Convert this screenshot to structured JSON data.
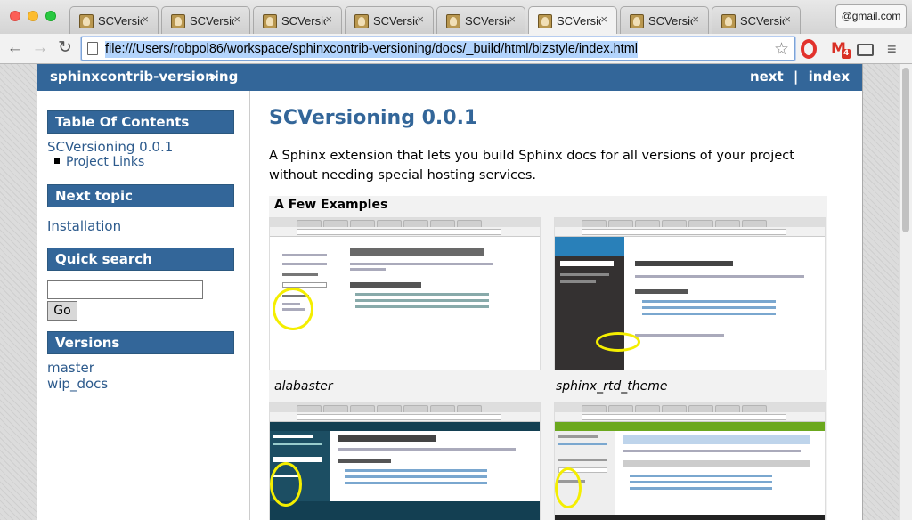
{
  "browser": {
    "tabs": [
      {
        "label": "SCVersioning"
      },
      {
        "label": "SCVersioning"
      },
      {
        "label": "SCVersioning"
      },
      {
        "label": "SCVersioning"
      },
      {
        "label": "SCVersioning"
      },
      {
        "label": "SCVersioning"
      },
      {
        "label": "SCVersioning"
      },
      {
        "label": "SCVersioning"
      }
    ],
    "tab_close_glyph": "×",
    "profile_label": "@gmail.com",
    "url": "file:///Users/robpol86/workspace/sphinxcontrib-versioning/docs/_build/html/bizstyle/index.html",
    "gmail_badge": "4",
    "icons": {
      "back": "back-arrow-icon",
      "forward": "forward-arrow-icon",
      "reload": "reload-icon",
      "star": "star-icon",
      "menu": "menu-icon"
    }
  },
  "relbar": {
    "project": "sphinxcontrib-versioning",
    "raquo": "»",
    "next": "next",
    "separator": "|",
    "index": "index"
  },
  "sidebar": {
    "toc_heading": "Table Of Contents",
    "toc_item": "SCVersioning 0.0.1",
    "toc_sub_item": "Project Links",
    "next_heading": "Next topic",
    "next_link": "Installation",
    "search_heading": "Quick search",
    "search_button": "Go",
    "versions_heading": "Versions",
    "versions": [
      "master",
      "wip_docs"
    ]
  },
  "content": {
    "title": "SCVersioning 0.0.1",
    "intro": "A Sphinx extension that lets you build Sphinx docs for all versions of your project without needing special hosting services.",
    "examples_heading": "A Few Examples",
    "examples": [
      {
        "caption": "alabaster"
      },
      {
        "caption": "sphinx_rtd_theme"
      },
      {
        "caption": ""
      },
      {
        "caption": ""
      }
    ]
  },
  "colors": {
    "accent": "#336699",
    "link": "#2c5a8c",
    "highlight_ring": "#f4ee00"
  }
}
